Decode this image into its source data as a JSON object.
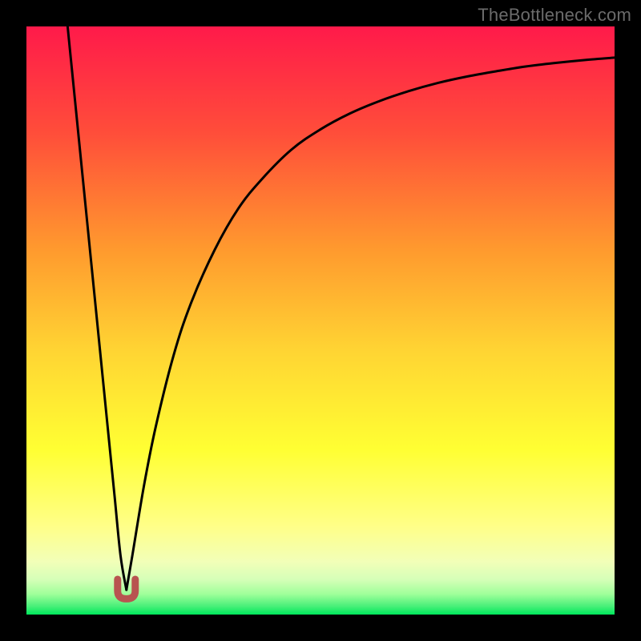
{
  "watermark": "TheBottleneck.com",
  "colors": {
    "frame": "#000000",
    "gradient_top": "#ff1a4a",
    "gradient_mid_upper": "#ff7a2e",
    "gradient_mid": "#ffd433",
    "gradient_mid_lower": "#ffff66",
    "gradient_lower": "#f6ffb0",
    "gradient_bottom": "#00e85c",
    "curve": "#000000",
    "marker": "#b85450"
  },
  "chart_data": {
    "type": "line",
    "title": "",
    "xlabel": "",
    "ylabel": "",
    "xlim": [
      0,
      100
    ],
    "ylim": [
      0,
      100
    ],
    "marker": {
      "x": 17,
      "y": 4.2,
      "shape": "u",
      "color": "#b85450"
    },
    "series": [
      {
        "name": "left-branch",
        "x": [
          7,
          8,
          9,
          10,
          11,
          12,
          13,
          14,
          15,
          16,
          17
        ],
        "y": [
          100,
          90,
          80,
          70,
          60,
          50,
          40,
          30,
          20,
          10,
          4.2
        ]
      },
      {
        "name": "right-branch",
        "x": [
          17,
          18,
          20,
          22,
          25,
          28,
          32,
          36,
          40,
          45,
          50,
          55,
          60,
          65,
          70,
          75,
          80,
          85,
          90,
          95,
          100
        ],
        "y": [
          4.2,
          10,
          22,
          32,
          44,
          53,
          62,
          69,
          74,
          79,
          82.5,
          85.2,
          87.3,
          89,
          90.4,
          91.5,
          92.4,
          93.2,
          93.8,
          94.3,
          94.7
        ]
      }
    ]
  }
}
